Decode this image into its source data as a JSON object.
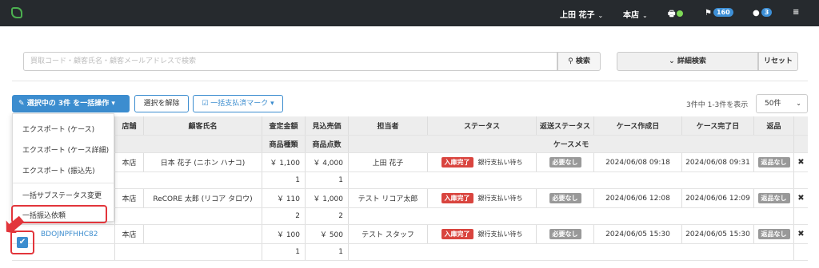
{
  "topbar": {
    "user": "上田 花子",
    "store": "本店",
    "flag_count": "160",
    "chat_count": "3"
  },
  "search": {
    "placeholder": "買取コード・顧客氏名・顧客メールアドレスで検索",
    "search_label": "検索",
    "advanced_label": "詳細検索",
    "reset_label": "リセット"
  },
  "actions": {
    "bulk_label": "選択中の 3件 を一括操作",
    "clear_label": "選択を解除",
    "paid_label": "一括支払済マーク",
    "count_text": "3件中 1-3件を表示",
    "per_page": "50件"
  },
  "menu": {
    "items": [
      "エクスポート (ケース)",
      "エクスポート (ケース詳細)",
      "エクスポート (振込先)",
      "一括サブステータス変更",
      "一括振込依頼"
    ]
  },
  "table": {
    "headers": {
      "store": "店舗",
      "customer": "顧客氏名",
      "assess": "査定金額",
      "estimate": "見込売価",
      "staff": "担当者",
      "status": "ステータス",
      "return_status": "返送ステータス",
      "created": "ケース作成日",
      "completed": "ケース完了日",
      "return": "返品",
      "item_types": "商品種類",
      "item_count": "商品点数",
      "memo": "ケースメモ"
    },
    "rows": [
      {
        "code": "",
        "store": "本店",
        "customer": "日本 花子 (ニホン ハナコ)",
        "assess": "￥ 1,100",
        "estimate": "￥ 4,000",
        "staff": "上田 花子",
        "status": "入庫完了",
        "sub_status": "銀行支払い待ち",
        "return_status": "必要なし",
        "created": "2024/06/08 09:18",
        "completed": "2024/06/08 09:31",
        "return": "返品なし",
        "item_types": "1",
        "item_count": "1"
      },
      {
        "code": "",
        "store": "本店",
        "customer": "ReCORE 太郎 (リコア タロウ)",
        "assess": "￥ 110",
        "estimate": "￥ 1,000",
        "staff": "テスト リコア太郎",
        "status": "入庫完了",
        "sub_status": "銀行支払い待ち",
        "return_status": "必要なし",
        "created": "2024/06/06 12:08",
        "completed": "2024/06/06 12:09",
        "return": "返品なし",
        "item_types": "2",
        "item_count": "2"
      },
      {
        "code": "BDOJNPFHHC82",
        "store": "本店",
        "customer": "",
        "assess": "￥ 100",
        "estimate": "￥ 500",
        "staff": "テスト スタッフ",
        "status": "入庫完了",
        "sub_status": "銀行支払い待ち",
        "return_status": "必要なし",
        "created": "2024/06/05 15:30",
        "completed": "2024/06/05 15:30",
        "return": "返品なし",
        "item_types": "1",
        "item_count": "1"
      }
    ]
  },
  "colors": {
    "topbar": "#262a2e",
    "primary": "#3c8dcf",
    "highlight": "#e2353b",
    "status_red": "#d9443e"
  }
}
